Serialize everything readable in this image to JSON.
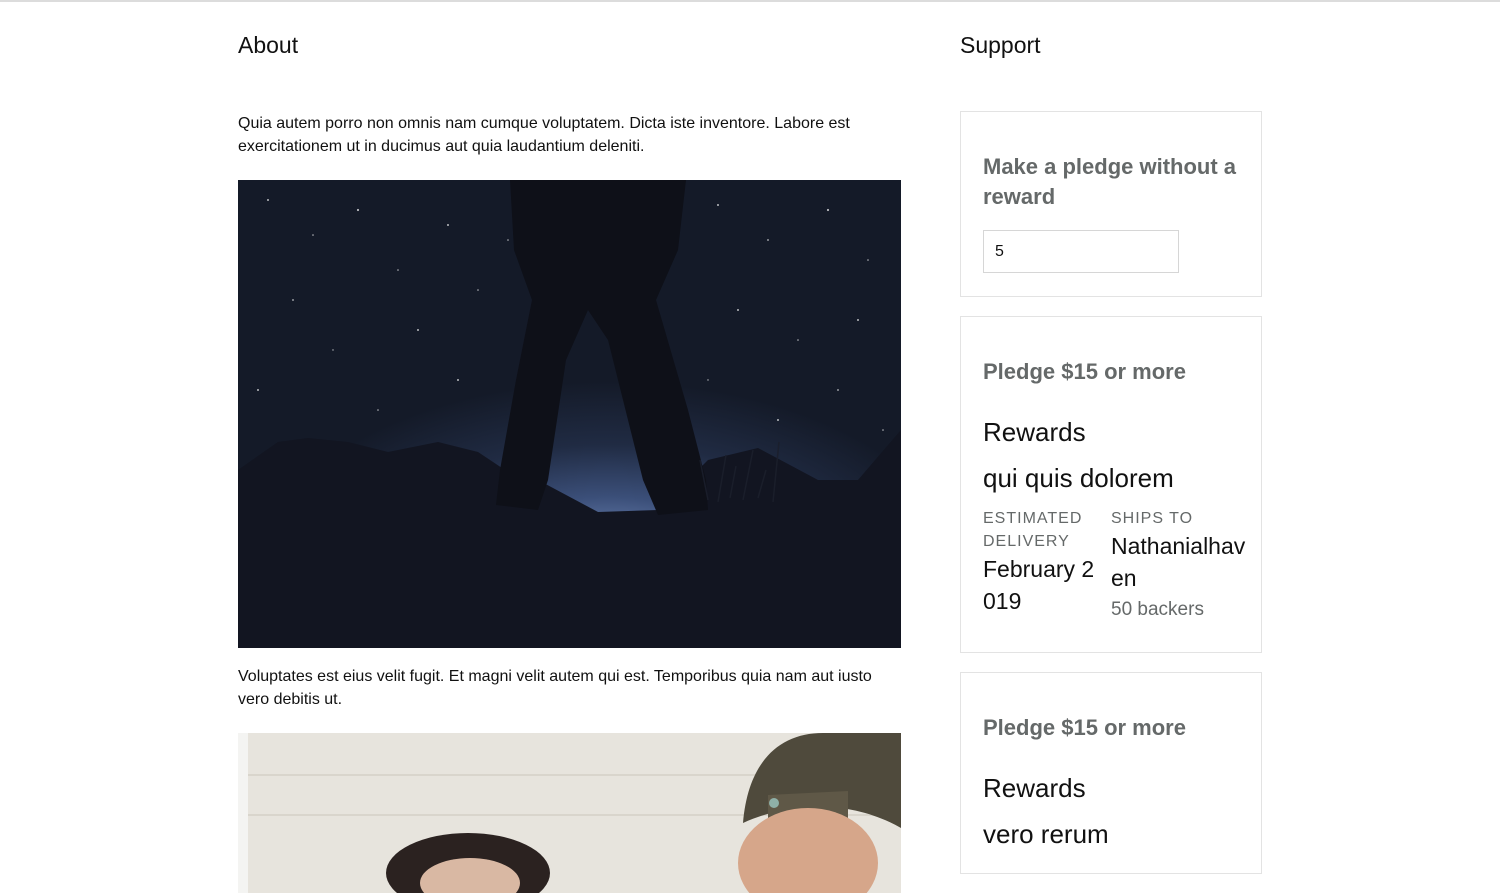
{
  "about": {
    "heading": "About",
    "paragraph_1": "Quia autem porro non omnis nam cumque voluptatem. Dicta iste inventore. Labore est exercitationem ut in ducimus aut quia laudantium deleniti.",
    "paragraph_2": "Voluptates est eius velit fugit. Et magni velit autem qui est. Temporibus quia nam aut iusto vero debitis ut."
  },
  "support": {
    "heading": "Support",
    "no_reward": {
      "title": "Make a pledge without a reward",
      "amount_value": "5"
    },
    "rewards": [
      {
        "title": "Pledge $15 or more",
        "rewards_label": "Rewards",
        "name": "qui quis dolorem",
        "delivery_label": "ESTIMATED DELIVERY",
        "delivery_value": "February 2019",
        "ships_label": "SHIPS TO",
        "ships_value": "Nathanialhaven",
        "backers": "50 backers"
      },
      {
        "title": "Pledge $15 or more",
        "rewards_label": "Rewards",
        "name": "vero rerum"
      }
    ]
  },
  "colors": {
    "muted_text": "#656969",
    "card_border": "#e3e3e3",
    "body_text": "#111111"
  }
}
